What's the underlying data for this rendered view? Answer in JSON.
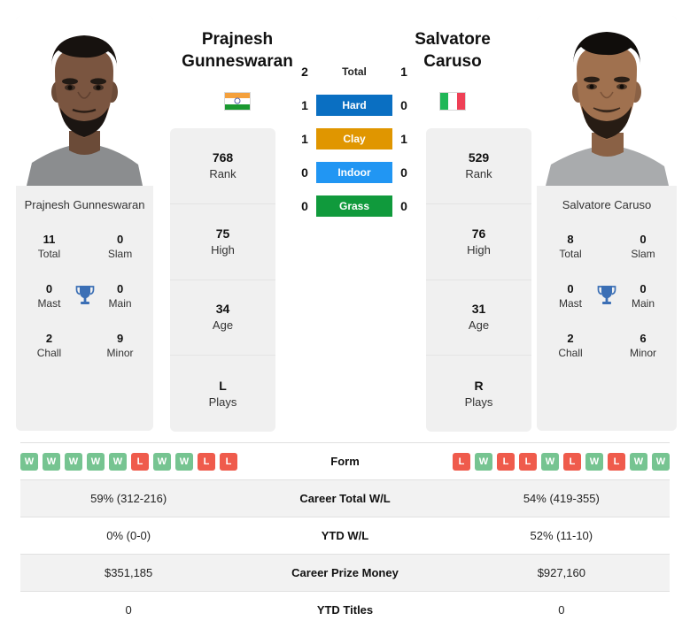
{
  "players": {
    "left": {
      "first_name": "Prajnesh",
      "last_name": "Gunneswaran",
      "full_name": "Prajnesh Gunneswaran",
      "flag": "india-flag",
      "titles": {
        "total": "11",
        "total_label": "Total",
        "slam": "0",
        "slam_label": "Slam",
        "mast": "0",
        "mast_label": "Mast",
        "main": "0",
        "main_label": "Main",
        "chall": "2",
        "chall_label": "Chall",
        "minor": "9",
        "minor_label": "Minor"
      },
      "info": [
        {
          "value": "768",
          "label": "Rank"
        },
        {
          "value": "75",
          "label": "High"
        },
        {
          "value": "34",
          "label": "Age"
        },
        {
          "value": "L",
          "label": "Plays"
        }
      ],
      "form": [
        "W",
        "W",
        "W",
        "W",
        "W",
        "L",
        "W",
        "W",
        "L",
        "L"
      ]
    },
    "right": {
      "first_name": "Salvatore",
      "last_name": "Caruso",
      "full_name": "Salvatore Caruso",
      "flag": "italy-flag",
      "titles": {
        "total": "8",
        "total_label": "Total",
        "slam": "0",
        "slam_label": "Slam",
        "mast": "0",
        "mast_label": "Mast",
        "main": "0",
        "main_label": "Main",
        "chall": "2",
        "chall_label": "Chall",
        "minor": "6",
        "minor_label": "Minor"
      },
      "info": [
        {
          "value": "529",
          "label": "Rank"
        },
        {
          "value": "76",
          "label": "High"
        },
        {
          "value": "31",
          "label": "Age"
        },
        {
          "value": "R",
          "label": "Plays"
        }
      ],
      "form": [
        "L",
        "W",
        "L",
        "L",
        "W",
        "L",
        "W",
        "L",
        "W",
        "W"
      ]
    }
  },
  "h2h": [
    {
      "label": "Total",
      "left": "2",
      "right": "1",
      "color": "",
      "style": "plain"
    },
    {
      "label": "Hard",
      "left": "1",
      "right": "0",
      "color": "#0a6fc2",
      "style": "bar"
    },
    {
      "label": "Clay",
      "left": "1",
      "right": "1",
      "color": "#e09600",
      "style": "bar"
    },
    {
      "label": "Indoor",
      "left": "0",
      "right": "0",
      "color": "#2196f3",
      "style": "bar"
    },
    {
      "label": "Grass",
      "left": "0",
      "right": "0",
      "color": "#109a3c",
      "style": "bar"
    }
  ],
  "table": {
    "form_label": "Form",
    "rows": [
      {
        "label": "Career Total W/L",
        "left": "59% (312-216)",
        "right": "54% (419-355)"
      },
      {
        "label": "YTD W/L",
        "left": "0% (0-0)",
        "right": "52% (11-10)"
      },
      {
        "label": "Career Prize Money",
        "left": "$351,185",
        "right": "$927,160"
      },
      {
        "label": "YTD Titles",
        "left": "0",
        "right": "0"
      }
    ]
  },
  "colors": {
    "win_badge": "#76c491",
    "loss_badge": "#ef5b4c",
    "trophy": "#3b6fb5",
    "card_bg": "#f0f0f0",
    "row_alt": "#f2f2f2"
  },
  "icons": {
    "trophy": "trophy-icon"
  }
}
